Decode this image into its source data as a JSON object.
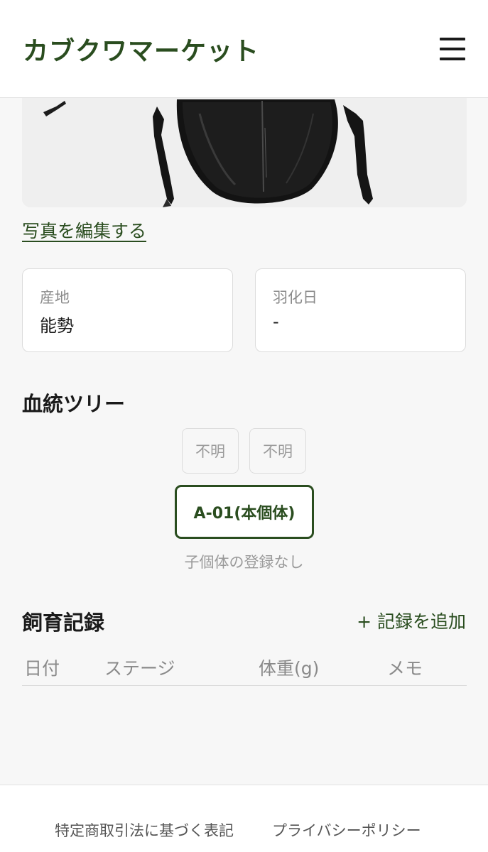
{
  "header": {
    "brand": "カブクワマーケット",
    "menu_icon": "hamburger-icon"
  },
  "photo": {
    "edit_link": "写真を編集する"
  },
  "info": {
    "origin_label": "産地",
    "origin_value": "能勢",
    "emergence_label": "羽化日",
    "emergence_value": "-"
  },
  "lineage": {
    "title": "血統ツリー",
    "father": "不明",
    "mother": "不明",
    "self": "A-01(本個体)",
    "children": "子個体の登録なし"
  },
  "records": {
    "title": "飼育記録",
    "add_label": "+ 記録を追加",
    "columns": [
      "日付",
      "ステージ",
      "体重(g)",
      "メモ"
    ]
  },
  "footer": {
    "links": [
      "特定商取引法に基づく表記",
      "プライバシーポリシー"
    ]
  },
  "colors": {
    "accent": "#2a4d1f",
    "background": "#f7f7f7"
  }
}
